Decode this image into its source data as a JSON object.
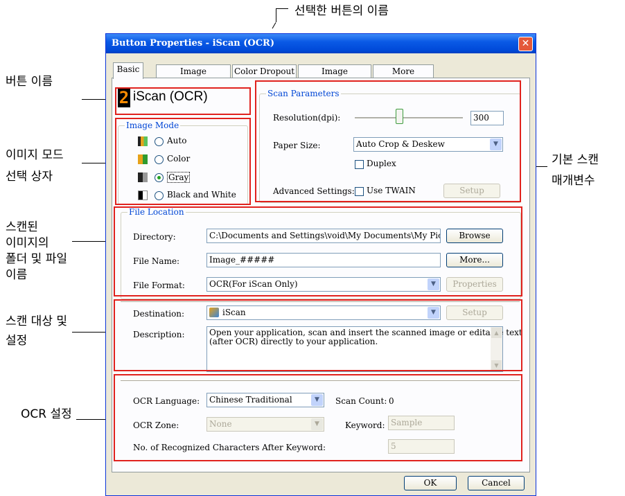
{
  "annotations": {
    "selected_button_name": "선택한 버튼의 이름",
    "button_name": "버튼 이름",
    "image_mode_line1": "이미지 모드",
    "image_mode_line2": "선택 상자",
    "scan_params_line1": "기본 스캔",
    "scan_params_line2": "매개변수",
    "file_line1": "스캔된",
    "file_line2": "이미지의",
    "file_line3": "폴더 및 파일",
    "file_line4": "이름",
    "dest_line1": "스캔 대상 및",
    "dest_line2": "설정",
    "ocr": "OCR 설정"
  },
  "dialog": {
    "title": "Button Properties - iScan (OCR)",
    "close_glyph": "✕",
    "tabs": [
      "Basic",
      "Image Adjustment",
      "Color Dropout",
      "Image Processing",
      "More Settings"
    ]
  },
  "button_display": {
    "number": "2",
    "name": "iScan (OCR)"
  },
  "image_mode": {
    "title": "Image Mode",
    "options": [
      "Auto",
      "Color",
      "Gray",
      "Black and White"
    ],
    "selected": "Gray"
  },
  "scan_params": {
    "title": "Scan Parameters",
    "resolution_label": "Resolution(dpi):",
    "resolution_value": "300",
    "paper_size_label": "Paper Size:",
    "paper_size_value": "Auto Crop & Deskew",
    "duplex_label": "Duplex",
    "advanced_label": "Advanced Settings:",
    "twain_label": "Use TWAIN",
    "setup_label": "Setup"
  },
  "file_location": {
    "title": "File Location",
    "directory_label": "Directory:",
    "directory_value": "C:\\Documents and Settings\\void\\My Documents\\My Pictures",
    "browse_label": "Browse",
    "filename_label": "File Name:",
    "filename_value": "Image_#####",
    "more_label": "More...",
    "format_label": "File Format:",
    "format_value": "OCR(For iScan Only)",
    "properties_label": "Properties"
  },
  "destination": {
    "label": "Destination:",
    "value": "iScan",
    "setup_label": "Setup",
    "description_label": "Description:",
    "description_line1": "Open your application, scan and insert the scanned image or editable text",
    "description_line2": "(after OCR) directly to your application."
  },
  "ocr": {
    "language_label": "OCR Language:",
    "language_value": "Chinese Traditional",
    "scan_count_label": "Scan Count:",
    "scan_count_value": "0",
    "zone_label": "OCR Zone:",
    "zone_value": "None",
    "keyword_label": "Keyword:",
    "keyword_value": "Sample",
    "chars_label": "No. of Recognized Characters After Keyword:",
    "chars_value": "5"
  },
  "footer": {
    "ok_label": "OK",
    "cancel_label": "Cancel"
  },
  "colors": {
    "accent_red": "#e0211d",
    "title_blue": "#0a5ae6",
    "group_title": "#0046d5"
  }
}
